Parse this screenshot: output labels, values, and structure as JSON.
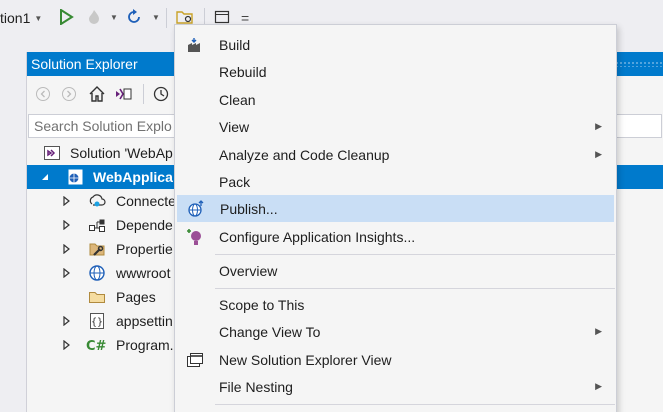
{
  "toolbar": {
    "config_label": "tion1",
    "start_icon": "play-icon",
    "hot_reload_icon": "flame-icon",
    "refresh_icon": "refresh-icon",
    "open_folder_icon": "folder-search-icon",
    "window_icon": "window-icon",
    "overflow": "="
  },
  "solution_explorer": {
    "title": "Solution Explorer",
    "search_placeholder": "Search Solution Explo",
    "tree": [
      {
        "label": "Solution 'WebAp",
        "icon": "solution-icon",
        "level": 0,
        "expander": "",
        "selected": false
      },
      {
        "label": "WebApplica",
        "icon": "web-project-icon",
        "level": 1,
        "expander": "expanded",
        "selected": true
      },
      {
        "label": "Connecte",
        "icon": "connected-services-icon",
        "level": 2,
        "expander": "collapsed",
        "selected": false
      },
      {
        "label": "Depende",
        "icon": "dependencies-icon",
        "level": 2,
        "expander": "collapsed",
        "selected": false
      },
      {
        "label": "Propertie",
        "icon": "properties-wrench-icon",
        "level": 2,
        "expander": "collapsed",
        "selected": false
      },
      {
        "label": "wwwroot",
        "icon": "globe-icon",
        "level": 2,
        "expander": "collapsed",
        "selected": false
      },
      {
        "label": "Pages",
        "icon": "folder-icon",
        "level": 2,
        "expander": "",
        "selected": false
      },
      {
        "label": "appsettin",
        "icon": "json-file-icon",
        "level": 2,
        "expander": "collapsed",
        "selected": false
      },
      {
        "label": "Program.",
        "icon": "csharp-file-icon",
        "level": 2,
        "expander": "collapsed",
        "selected": false
      }
    ]
  },
  "context_menu": {
    "items": [
      {
        "label": "Build",
        "icon": "build-icon",
        "submenu": false
      },
      {
        "label": "Rebuild",
        "icon": "",
        "submenu": false
      },
      {
        "label": "Clean",
        "icon": "",
        "submenu": false
      },
      {
        "label": "View",
        "icon": "",
        "submenu": true
      },
      {
        "label": "Analyze and Code Cleanup",
        "icon": "",
        "submenu": true
      },
      {
        "label": "Pack",
        "icon": "",
        "submenu": false
      },
      {
        "label": "Publish...",
        "icon": "publish-globe-icon",
        "submenu": false,
        "highlighted": true
      },
      {
        "label": "Configure Application Insights...",
        "icon": "app-insights-icon",
        "submenu": false
      },
      {
        "label": "Overview",
        "icon": "",
        "submenu": false
      },
      {
        "label": "Scope to This",
        "icon": "",
        "submenu": false
      },
      {
        "label": "Change View To",
        "icon": "",
        "submenu": true
      },
      {
        "label": "New Solution Explorer View",
        "icon": "new-explorer-view-icon",
        "submenu": false
      },
      {
        "label": "File Nesting",
        "icon": "",
        "submenu": true
      }
    ]
  },
  "colors": {
    "accent": "#007acc",
    "menu_highlight": "#c9def5",
    "play_green": "#388a34",
    "vs_purple": "#68217a"
  }
}
